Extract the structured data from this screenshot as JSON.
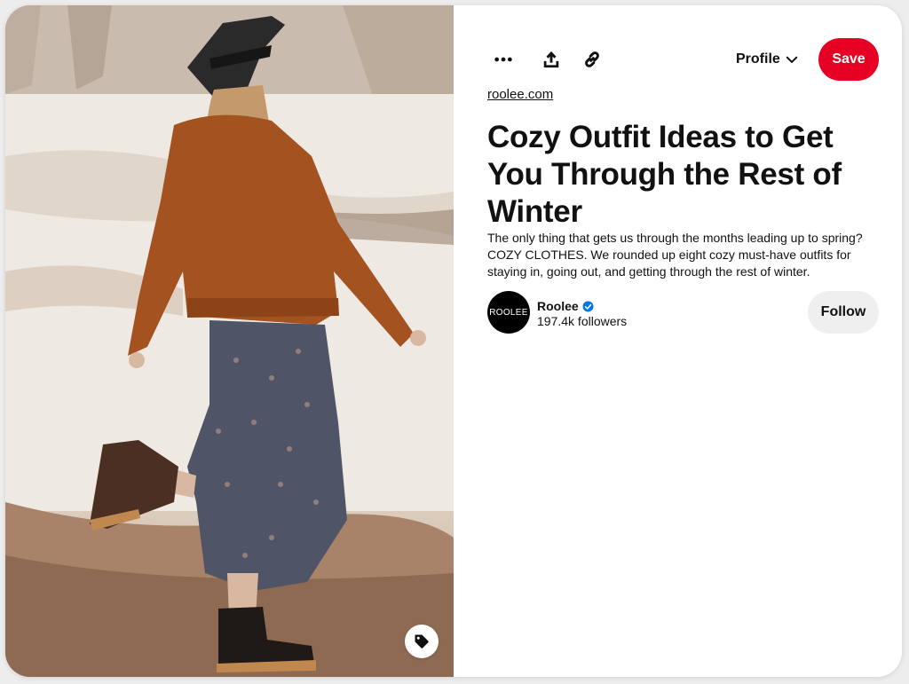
{
  "colors": {
    "save": "#e60023",
    "verified": "#0074e8",
    "text": "#111111",
    "follow_bg": "#efefef"
  },
  "image": {
    "alt": "Woman in a rust sherpa jacket, black hat, floral midi skirt and Chelsea boots walking in a snowy field",
    "tag_icon": "tag-icon"
  },
  "toolbar": {
    "more_icon": "more-dots-icon",
    "share_icon": "share-upload-icon",
    "link_icon": "link-icon",
    "profile_label": "Profile",
    "save_label": "Save"
  },
  "pin": {
    "source": "roolee.com",
    "title": "Cozy Outfit Ideas to Get You Through the Rest of Winter",
    "description": "The only thing that gets us through the months leading up to spring? COZY CLOTHES. We rounded up eight cozy must-have outfits for staying in, going out, and getting through the rest of winter."
  },
  "creator": {
    "avatar_text": "ROOLEE",
    "name": "Roolee",
    "verified": true,
    "followers": "197.4k followers",
    "follow_label": "Follow"
  }
}
